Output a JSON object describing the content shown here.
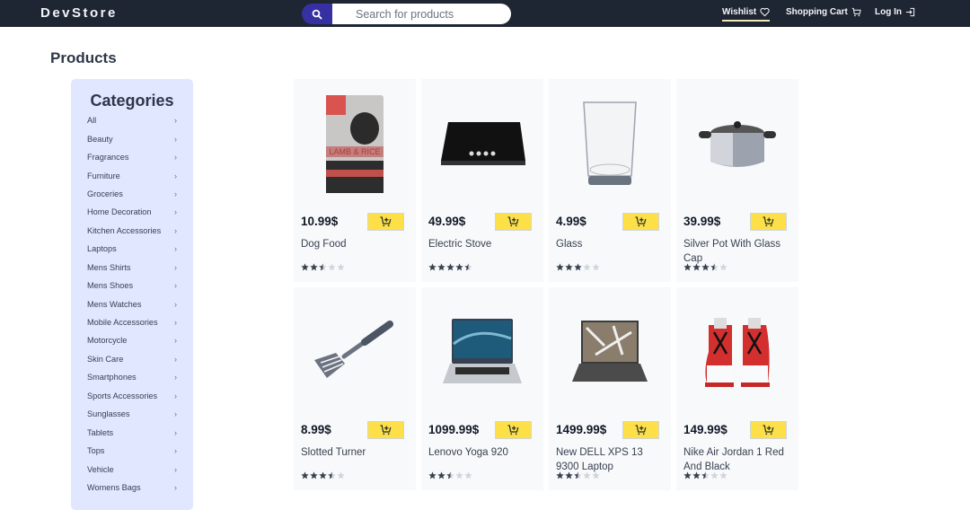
{
  "app": {
    "logo": "DevStore"
  },
  "search": {
    "placeholder": "Search for products",
    "value": ""
  },
  "nav": {
    "wishlist": "Wishlist",
    "cart": "Shopping Cart",
    "login": "Log In",
    "active": "wishlist"
  },
  "page": {
    "title": "Products"
  },
  "sidebar": {
    "title": "Categories",
    "items": [
      "All",
      "Beauty",
      "Fragrances",
      "Furniture",
      "Groceries",
      "Home Decoration",
      "Kitchen Accessories",
      "Laptops",
      "Mens Shirts",
      "Mens Shoes",
      "Mens Watches",
      "Mobile Accessories",
      "Motorcycle",
      "Skin Care",
      "Smartphones",
      "Sports Accessories",
      "Sunglasses",
      "Tablets",
      "Tops",
      "Vehicle",
      "Womens Bags"
    ]
  },
  "colors": {
    "navbar": "#1e2633",
    "search_button": "#3730a3",
    "sidebar_bg": "#e0e7ff",
    "cart_button": "#fde047",
    "card_bg": "#f8f9fb",
    "star_filled": "#374151",
    "star_empty": "#d1d5db"
  },
  "products": [
    {
      "name": "Dog Food",
      "price": "10.99$",
      "rating": 2.5,
      "image": "dog-food-bag"
    },
    {
      "name": "Electric Stove",
      "price": "49.99$",
      "rating": 4.5,
      "image": "electric-stove"
    },
    {
      "name": "Glass",
      "price": "4.99$",
      "rating": 3,
      "image": "drinking-glass"
    },
    {
      "name": "Silver Pot With Glass Cap",
      "price": "39.99$",
      "rating": 3.5,
      "image": "silver-pot"
    },
    {
      "name": "Slotted Turner",
      "price": "8.99$",
      "rating": 3.5,
      "image": "slotted-turner"
    },
    {
      "name": "Lenovo Yoga 920",
      "price": "1099.99$",
      "rating": 2.5,
      "image": "lenovo-laptop"
    },
    {
      "name": "New DELL XPS 13 9300 Laptop",
      "price": "1499.99$",
      "rating": 2.5,
      "image": "dell-laptop"
    },
    {
      "name": "Nike Air Jordan 1 Red And Black",
      "price": "149.99$",
      "rating": 2.5,
      "image": "sneakers"
    }
  ]
}
